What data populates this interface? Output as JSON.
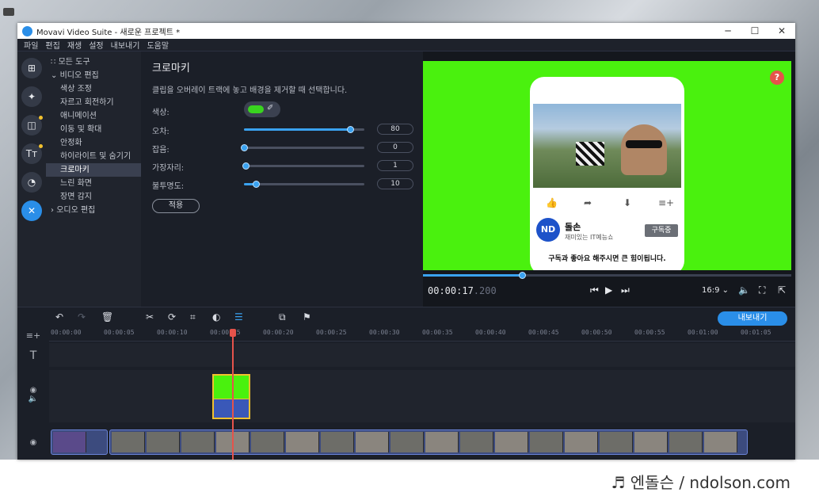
{
  "window": {
    "title": "Movavi Video Suite - 새로운 프로젝트 *",
    "minimize": "─",
    "maximize": "☐",
    "close": "✕"
  },
  "menu": [
    "파일",
    "편집",
    "재생",
    "설정",
    "내보내기",
    "도움말"
  ],
  "left_toolbar": {
    "icons": [
      "import-icon",
      "magic-icon",
      "filter-icon",
      "titles-icon",
      "transition-icon",
      "tools-icon"
    ],
    "glyphs": [
      "⊞",
      "✦",
      "◫",
      "Tт",
      "◔",
      "✕"
    ]
  },
  "tools_list": [
    {
      "label": "모든 도구",
      "prefix": "∷"
    },
    {
      "label": "비디오 편집",
      "prefix": "⌄"
    },
    {
      "label": "색상 조정",
      "prefix": ""
    },
    {
      "label": "자르고 회전하기",
      "prefix": ""
    },
    {
      "label": "애니메이션",
      "prefix": ""
    },
    {
      "label": "이동 및 확대",
      "prefix": ""
    },
    {
      "label": "안정화",
      "prefix": ""
    },
    {
      "label": "하이라이트 및 숨기기",
      "prefix": ""
    },
    {
      "label": "크로마키",
      "prefix": ""
    },
    {
      "label": "느린 화면",
      "prefix": ""
    },
    {
      "label": "장면 감지",
      "prefix": ""
    },
    {
      "label": "오디오 편집",
      "prefix": "›"
    }
  ],
  "chroma": {
    "title": "크로마키",
    "description": "클립을 오버레이 트랙에 놓고 배경을 제거할 때 선택합니다.",
    "color_label": "색상:",
    "color_value": "#39d41f",
    "eyedropper": "✐",
    "sliders": [
      {
        "label": "오차:",
        "value": "80",
        "fraction": 0.88
      },
      {
        "label": "잡음:",
        "value": "0",
        "fraction": 0.0
      },
      {
        "label": "가장자리:",
        "value": "1",
        "fraction": 0.01
      },
      {
        "label": "불투명도:",
        "value": "10",
        "fraction": 0.1
      }
    ],
    "apply": "적용"
  },
  "preview": {
    "help": "?",
    "channel_logo": "ND",
    "channel_name": "돌손",
    "channel_sub": "재미있는 IT예능쇼",
    "subscribe": "구독중",
    "caption": "구독과 좋아요 해주시면 큰 힘이됩니다.",
    "phone_icons": [
      "👍",
      "➦",
      "⬇",
      "≡+"
    ],
    "progress": 0.268,
    "time_main": "00:00:17",
    "time_ms": ".200",
    "prev": "⏮",
    "play": "▶",
    "next": "⏭",
    "aspect": "16:9 ⌄",
    "volume": "🔈",
    "fullscreen": "⛶",
    "popout": "⇱"
  },
  "timeline": {
    "tools": [
      "↶",
      "↷",
      "🗑",
      "✂",
      "⟳",
      "⌗",
      "◐",
      "☰",
      "⧉",
      "⚑"
    ],
    "export": "내보내기",
    "add_track": "≡+",
    "ticks": [
      "00:00:00",
      "00:00:05",
      "00:00:10",
      "00:00:15",
      "00:00:20",
      "00:00:25",
      "00:00:30",
      "00:00:35",
      "00:00:40",
      "00:00:45",
      "00:00:50",
      "00:00:55",
      "00:01:00",
      "00:01:05"
    ],
    "text_track": "T"
  },
  "watermark": "♬ 엔돌슨 / ndolson.com",
  "colors": {
    "accent": "#2a8ee8",
    "chroma": "#4af10e",
    "playhead": "#e5534b"
  }
}
